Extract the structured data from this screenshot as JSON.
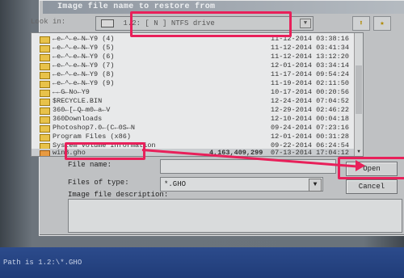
{
  "dialog": {
    "title": "Image file name to restore from",
    "look_in_label": "Look in:",
    "look_in_value": "1.2: [  N  ] NTFS drive"
  },
  "files": [
    {
      "name": "←e←^←e←N←Y9 (4)",
      "size": "",
      "date": "11-12-2014 03:38:16"
    },
    {
      "name": "←e←^←e←N←Y9 (5)",
      "size": "",
      "date": "11-12-2014 03:41:34"
    },
    {
      "name": "←e←^←e←N←Y9 (6)",
      "size": "",
      "date": "11-12-2014 13:12:20"
    },
    {
      "name": "←e←^←e←N←Y9 (7)",
      "size": "",
      "date": "12-01-2014 03:34:14"
    },
    {
      "name": "←e←^←e←N←Y9 (8)",
      "size": "",
      "date": "11-17-2014 09:54:24"
    },
    {
      "name": "←e←^←e←N←Y9 (9)",
      "size": "",
      "date": "11-19-2014 02:11:50"
    },
    {
      "name": "←←G←No←Y9",
      "size": "",
      "date": "10-17-2014 00:20:56"
    },
    {
      "name": "$RECYCLE.BIN",
      "size": "",
      "date": "12-24-2014 07:04:52"
    },
    {
      "name": "360←[←Q←m0←a←V",
      "size": "",
      "date": "12-29-2014 02:46:22"
    },
    {
      "name": "360Downloads",
      "size": "",
      "date": "12-10-2014 00:04:18"
    },
    {
      "name": "Photoshop7.0←(C←0S←N",
      "size": "",
      "date": "09-24-2014 07:23:16"
    },
    {
      "name": "Program Files (x86)",
      "size": "",
      "date": "12-01-2014 00:31:28"
    },
    {
      "name": "System Volume Information",
      "size": "",
      "date": "09-22-2014 06:24:54"
    },
    {
      "name": "win8.gho",
      "size": "4,163,409,299",
      "date": "07-13-2014 17:04:12"
    }
  ],
  "labels": {
    "file_name": "File name:",
    "files_of_type": "Files of type:",
    "image_desc": "Image file description:"
  },
  "fields": {
    "file_name_value": "",
    "files_of_type_value": "*.GHO"
  },
  "buttons": {
    "open": "Open",
    "cancel": "Cancel"
  },
  "status": {
    "path_text": "Path is  1.2:\\*.GHO"
  },
  "colors": {
    "annotation": "#e8205a"
  }
}
